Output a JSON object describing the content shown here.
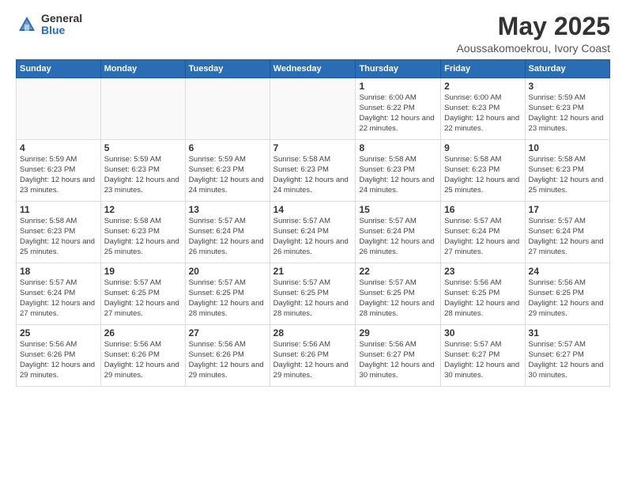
{
  "logo": {
    "general": "General",
    "blue": "Blue"
  },
  "title": "May 2025",
  "subtitle": "Aoussakomoekrou, Ivory Coast",
  "weekdays": [
    "Sunday",
    "Monday",
    "Tuesday",
    "Wednesday",
    "Thursday",
    "Friday",
    "Saturday"
  ],
  "weeks": [
    [
      {
        "day": "",
        "info": ""
      },
      {
        "day": "",
        "info": ""
      },
      {
        "day": "",
        "info": ""
      },
      {
        "day": "",
        "info": ""
      },
      {
        "day": "1",
        "info": "Sunrise: 6:00 AM\nSunset: 6:22 PM\nDaylight: 12 hours\nand 22 minutes."
      },
      {
        "day": "2",
        "info": "Sunrise: 6:00 AM\nSunset: 6:23 PM\nDaylight: 12 hours\nand 22 minutes."
      },
      {
        "day": "3",
        "info": "Sunrise: 5:59 AM\nSunset: 6:23 PM\nDaylight: 12 hours\nand 23 minutes."
      }
    ],
    [
      {
        "day": "4",
        "info": "Sunrise: 5:59 AM\nSunset: 6:23 PM\nDaylight: 12 hours\nand 23 minutes."
      },
      {
        "day": "5",
        "info": "Sunrise: 5:59 AM\nSunset: 6:23 PM\nDaylight: 12 hours\nand 23 minutes."
      },
      {
        "day": "6",
        "info": "Sunrise: 5:59 AM\nSunset: 6:23 PM\nDaylight: 12 hours\nand 24 minutes."
      },
      {
        "day": "7",
        "info": "Sunrise: 5:58 AM\nSunset: 6:23 PM\nDaylight: 12 hours\nand 24 minutes."
      },
      {
        "day": "8",
        "info": "Sunrise: 5:58 AM\nSunset: 6:23 PM\nDaylight: 12 hours\nand 24 minutes."
      },
      {
        "day": "9",
        "info": "Sunrise: 5:58 AM\nSunset: 6:23 PM\nDaylight: 12 hours\nand 25 minutes."
      },
      {
        "day": "10",
        "info": "Sunrise: 5:58 AM\nSunset: 6:23 PM\nDaylight: 12 hours\nand 25 minutes."
      }
    ],
    [
      {
        "day": "11",
        "info": "Sunrise: 5:58 AM\nSunset: 6:23 PM\nDaylight: 12 hours\nand 25 minutes."
      },
      {
        "day": "12",
        "info": "Sunrise: 5:58 AM\nSunset: 6:23 PM\nDaylight: 12 hours\nand 25 minutes."
      },
      {
        "day": "13",
        "info": "Sunrise: 5:57 AM\nSunset: 6:24 PM\nDaylight: 12 hours\nand 26 minutes."
      },
      {
        "day": "14",
        "info": "Sunrise: 5:57 AM\nSunset: 6:24 PM\nDaylight: 12 hours\nand 26 minutes."
      },
      {
        "day": "15",
        "info": "Sunrise: 5:57 AM\nSunset: 6:24 PM\nDaylight: 12 hours\nand 26 minutes."
      },
      {
        "day": "16",
        "info": "Sunrise: 5:57 AM\nSunset: 6:24 PM\nDaylight: 12 hours\nand 27 minutes."
      },
      {
        "day": "17",
        "info": "Sunrise: 5:57 AM\nSunset: 6:24 PM\nDaylight: 12 hours\nand 27 minutes."
      }
    ],
    [
      {
        "day": "18",
        "info": "Sunrise: 5:57 AM\nSunset: 6:24 PM\nDaylight: 12 hours\nand 27 minutes."
      },
      {
        "day": "19",
        "info": "Sunrise: 5:57 AM\nSunset: 6:25 PM\nDaylight: 12 hours\nand 27 minutes."
      },
      {
        "day": "20",
        "info": "Sunrise: 5:57 AM\nSunset: 6:25 PM\nDaylight: 12 hours\nand 28 minutes."
      },
      {
        "day": "21",
        "info": "Sunrise: 5:57 AM\nSunset: 6:25 PM\nDaylight: 12 hours\nand 28 minutes."
      },
      {
        "day": "22",
        "info": "Sunrise: 5:57 AM\nSunset: 6:25 PM\nDaylight: 12 hours\nand 28 minutes."
      },
      {
        "day": "23",
        "info": "Sunrise: 5:56 AM\nSunset: 6:25 PM\nDaylight: 12 hours\nand 28 minutes."
      },
      {
        "day": "24",
        "info": "Sunrise: 5:56 AM\nSunset: 6:25 PM\nDaylight: 12 hours\nand 29 minutes."
      }
    ],
    [
      {
        "day": "25",
        "info": "Sunrise: 5:56 AM\nSunset: 6:26 PM\nDaylight: 12 hours\nand 29 minutes."
      },
      {
        "day": "26",
        "info": "Sunrise: 5:56 AM\nSunset: 6:26 PM\nDaylight: 12 hours\nand 29 minutes."
      },
      {
        "day": "27",
        "info": "Sunrise: 5:56 AM\nSunset: 6:26 PM\nDaylight: 12 hours\nand 29 minutes."
      },
      {
        "day": "28",
        "info": "Sunrise: 5:56 AM\nSunset: 6:26 PM\nDaylight: 12 hours\nand 29 minutes."
      },
      {
        "day": "29",
        "info": "Sunrise: 5:56 AM\nSunset: 6:27 PM\nDaylight: 12 hours\nand 30 minutes."
      },
      {
        "day": "30",
        "info": "Sunrise: 5:57 AM\nSunset: 6:27 PM\nDaylight: 12 hours\nand 30 minutes."
      },
      {
        "day": "31",
        "info": "Sunrise: 5:57 AM\nSunset: 6:27 PM\nDaylight: 12 hours\nand 30 minutes."
      }
    ]
  ]
}
